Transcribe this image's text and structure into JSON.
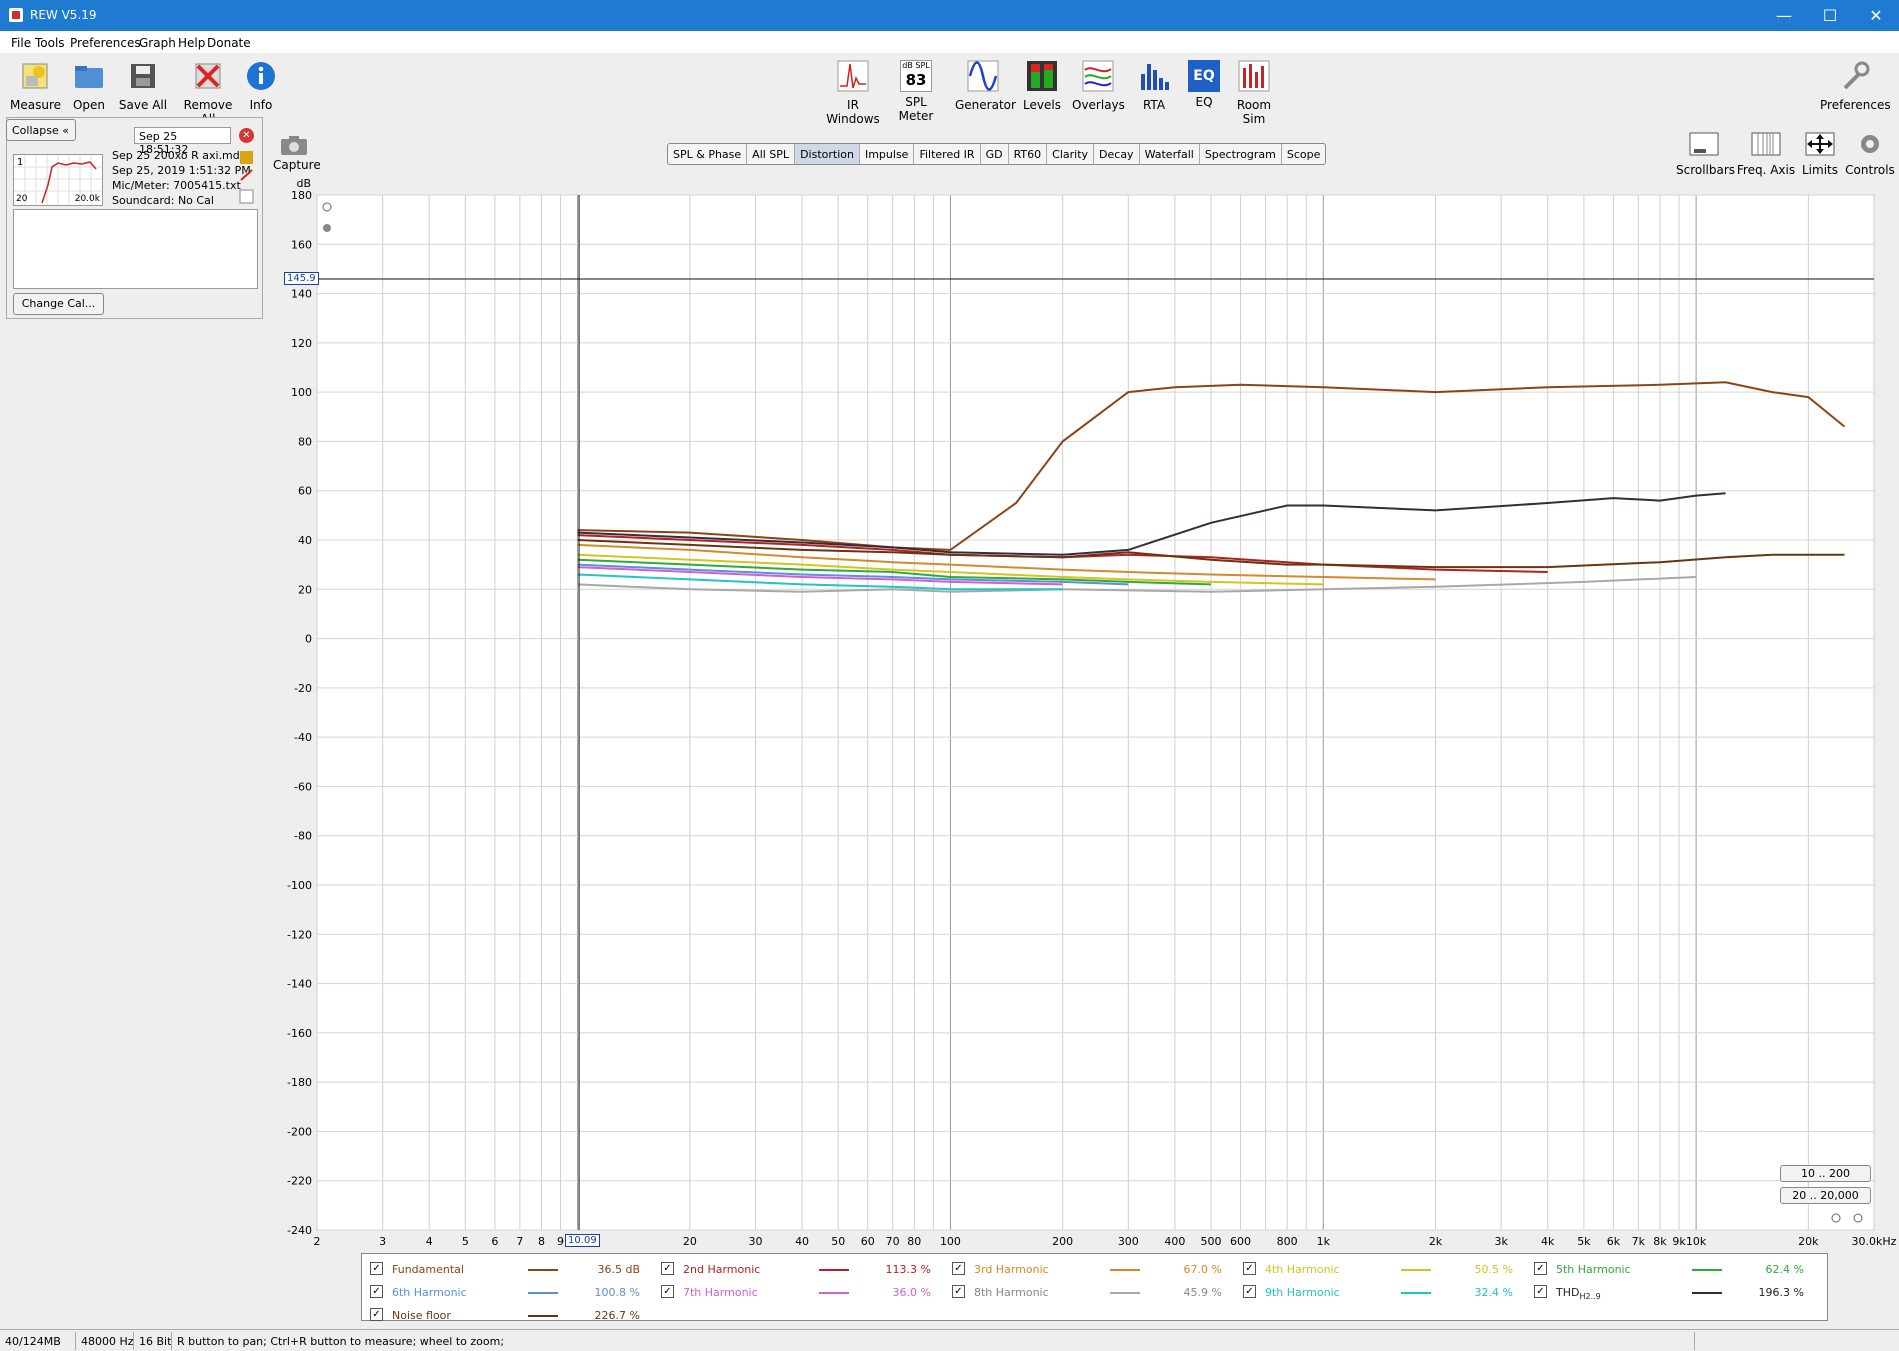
{
  "window": {
    "title": "REW V5.19",
    "min": "—",
    "max": "☐",
    "close": "✕"
  },
  "menu": [
    "File",
    "Tools",
    "Preferences",
    "Graph",
    "Help",
    "Donate"
  ],
  "toolbar_left": [
    {
      "label": "Measure",
      "icon": "measure-icon"
    },
    {
      "label": "Open",
      "icon": "folder-icon"
    },
    {
      "label": "Save All",
      "icon": "save-icon"
    },
    {
      "label": "Remove All",
      "icon": "remove-icon"
    },
    {
      "label": "Info",
      "icon": "info-icon"
    }
  ],
  "toolbar_center": [
    {
      "label": "IR Windows",
      "icon": "ir-windows-icon"
    },
    {
      "label": "SPL Meter",
      "icon": "spl-meter-icon",
      "badge_top": "dB SPL",
      "badge_value": "83"
    },
    {
      "label": "Generator",
      "icon": "generator-icon"
    },
    {
      "label": "Levels",
      "icon": "levels-icon"
    },
    {
      "label": "Overlays",
      "icon": "overlays-icon"
    },
    {
      "label": "RTA",
      "icon": "rta-icon"
    },
    {
      "label": "EQ",
      "icon": "eq-icon"
    },
    {
      "label": "Room Sim",
      "icon": "room-sim-icon"
    }
  ],
  "preferences_label": "Preferences",
  "graph_controls": [
    "Scrollbars",
    "Freq. Axis",
    "Limits",
    "Controls"
  ],
  "capture_label": "Capture",
  "left": {
    "collapse": "Collapse",
    "meas_title": "Sep 25 18:51:32",
    "meas_number": "1",
    "thumb_left": "20",
    "thumb_right": "20.0k",
    "info": [
      "Sep 25 200xo R axi.mdat",
      "Sep 25, 2019 1:51:32 PM",
      "Mic/Meter: 7005415.txt",
      "Soundcard: No Cal"
    ],
    "change_cal": "Change Cal..."
  },
  "tabs": [
    "SPL & Phase",
    "All SPL",
    "Distortion",
    "Impulse",
    "Filtered IR",
    "GD",
    "RT60",
    "Clarity",
    "Decay",
    "Waterfall",
    "Spectrogram",
    "Scope"
  ],
  "active_tab": "Distortion",
  "range_buttons": [
    "10 .. 200",
    "20 .. 20,000"
  ],
  "cursor": {
    "level": "145.9",
    "freq": "10.09"
  },
  "chart_data": {
    "type": "line",
    "ylabel": "dB",
    "xlabel": "",
    "x_scale": "log",
    "xlim": [
      2,
      30000
    ],
    "ylim": [
      -240,
      180
    ],
    "x_ticks": [
      2,
      3,
      4,
      5,
      6,
      7,
      8,
      9,
      20,
      30,
      40,
      50,
      60,
      70,
      80,
      100,
      200,
      300,
      400,
      500,
      600,
      800,
      1000,
      2000,
      3000,
      4000,
      5000,
      6000,
      7000,
      8000,
      9000,
      10000,
      20000,
      30000
    ],
    "x_tick_labels": [
      "2",
      "3",
      "4",
      "5",
      "6",
      "7",
      "8",
      "9",
      "20",
      "30",
      "40",
      "50",
      "60",
      "70",
      "80",
      "100",
      "200",
      "300",
      "400",
      "500",
      "600",
      "800",
      "1k",
      "2k",
      "3k",
      "4k",
      "5k",
      "6k",
      "7k",
      "8k",
      "9k",
      "10k",
      "20k",
      "30.0kHz"
    ],
    "y_ticks": [
      180,
      160,
      140,
      120,
      100,
      80,
      60,
      40,
      20,
      0,
      -20,
      -40,
      -60,
      -80,
      -100,
      -120,
      -140,
      -160,
      -180,
      -200,
      -220,
      -240
    ],
    "series": [
      {
        "name": "Fundamental",
        "color": "#8b4513",
        "x": [
          10,
          20,
          40,
          70,
          100,
          150,
          200,
          300,
          400,
          600,
          1000,
          2000,
          4000,
          8000,
          12000,
          16000,
          20000,
          25000
        ],
        "y": [
          44,
          43,
          40,
          37,
          36,
          55,
          80,
          100,
          102,
          103,
          102,
          100,
          102,
          103,
          104,
          100,
          98,
          86
        ]
      },
      {
        "name": "2nd Harmonic",
        "color": "#b22222",
        "x": [
          10,
          20,
          40,
          70,
          100,
          200,
          300,
          500,
          1000,
          2000,
          4000
        ],
        "y": [
          42,
          40,
          38,
          36,
          34,
          33,
          34,
          33,
          30,
          28,
          27
        ]
      },
      {
        "name": "3rd Harmonic",
        "color": "#d4892a",
        "x": [
          10,
          20,
          40,
          70,
          100,
          200,
          300,
          500,
          1000,
          2000
        ],
        "y": [
          38,
          36,
          33,
          31,
          30,
          28,
          27,
          26,
          25,
          24
        ]
      },
      {
        "name": "4th Harmonic",
        "color": "#d4c41e",
        "x": [
          10,
          20,
          40,
          70,
          100,
          200,
          300,
          500,
          1000
        ],
        "y": [
          34,
          32,
          30,
          28,
          27,
          25,
          24,
          23,
          22
        ]
      },
      {
        "name": "5th Harmonic",
        "color": "#2eaa3a",
        "x": [
          10,
          20,
          40,
          70,
          100,
          200,
          300,
          500
        ],
        "y": [
          32,
          30,
          28,
          27,
          25,
          24,
          23,
          22
        ]
      },
      {
        "name": "6th Harmonic",
        "color": "#5b8fd6",
        "x": [
          10,
          20,
          40,
          70,
          100,
          200,
          300
        ],
        "y": [
          30,
          28,
          26,
          25,
          24,
          23,
          22
        ]
      },
      {
        "name": "7th Harmonic",
        "color": "#d05fd0",
        "x": [
          10,
          20,
          40,
          70,
          100,
          200
        ],
        "y": [
          29,
          27,
          25,
          24,
          23,
          22
        ]
      },
      {
        "name": "8th Harmonic",
        "color": "#a8a8a8",
        "x": [
          10,
          20,
          40,
          70,
          100,
          200,
          500,
          1000,
          2000,
          5000,
          10000
        ],
        "y": [
          22,
          20,
          19,
          20,
          19,
          20,
          19,
          20,
          21,
          23,
          25
        ]
      },
      {
        "name": "9th Harmonic",
        "color": "#23c4c4",
        "x": [
          10,
          20,
          40,
          70,
          100,
          200
        ],
        "y": [
          26,
          24,
          22,
          21,
          20,
          20
        ]
      },
      {
        "name": "THD H2..9",
        "color": "#3a2a3a",
        "x": [
          10,
          20,
          40,
          70,
          100,
          200,
          300,
          500,
          800,
          1000,
          2000,
          4000,
          6000,
          8000,
          10000,
          12000
        ],
        "y": [
          43,
          41,
          39,
          37,
          35,
          34,
          36,
          47,
          54,
          54,
          52,
          55,
          57,
          56,
          58,
          59
        ]
      },
      {
        "name": "Noise floor",
        "color": "#6b3410",
        "x": [
          10,
          20,
          40,
          70,
          100,
          200,
          300,
          500,
          800,
          1000,
          2000,
          4000,
          8000,
          12000,
          16000,
          20000,
          25000
        ],
        "y": [
          40,
          38,
          36,
          35,
          34,
          33,
          35,
          32,
          30,
          30,
          29,
          29,
          31,
          33,
          34,
          34,
          34
        ]
      }
    ]
  },
  "legend": [
    {
      "name": "Fundamental",
      "value": "36.5 dB",
      "color": "#8b4513",
      "checked": true
    },
    {
      "name": "2nd Harmonic",
      "value": "113.3 %",
      "color": "#b22222",
      "checked": true
    },
    {
      "name": "3rd Harmonic",
      "value": "67.0 %",
      "color": "#d4892a",
      "checked": true
    },
    {
      "name": "4th Harmonic",
      "value": "50.5 %",
      "color": "#d4c41e",
      "checked": true
    },
    {
      "name": "5th Harmonic",
      "value": "62.4 %",
      "color": "#2eaa3a",
      "checked": true
    },
    {
      "name": "6th Harmonic",
      "value": "100.8 %",
      "color": "#5b8fd6",
      "checked": true
    },
    {
      "name": "7th Harmonic",
      "value": "36.0 %",
      "color": "#d05fd0",
      "checked": true
    },
    {
      "name": "8th Harmonic",
      "value": "45.9 %",
      "color": "#a8a8a8",
      "checked": true
    },
    {
      "name": "9th Harmonic",
      "value": "32.4 %",
      "color": "#23c4c4",
      "checked": true
    },
    {
      "name": "THD",
      "sub": "H2..9",
      "value": "196.3 %",
      "color": "#3a2a3a",
      "checked": true
    },
    {
      "name": "Noise floor",
      "value": "226.7 %",
      "color": "#6b3410",
      "checked": true
    }
  ],
  "status": {
    "memory": "40/124MB",
    "rate": "48000 Hz",
    "bits": "16 Bit",
    "hint": "R button to pan; Ctrl+R button to measure; wheel to zoom;"
  }
}
